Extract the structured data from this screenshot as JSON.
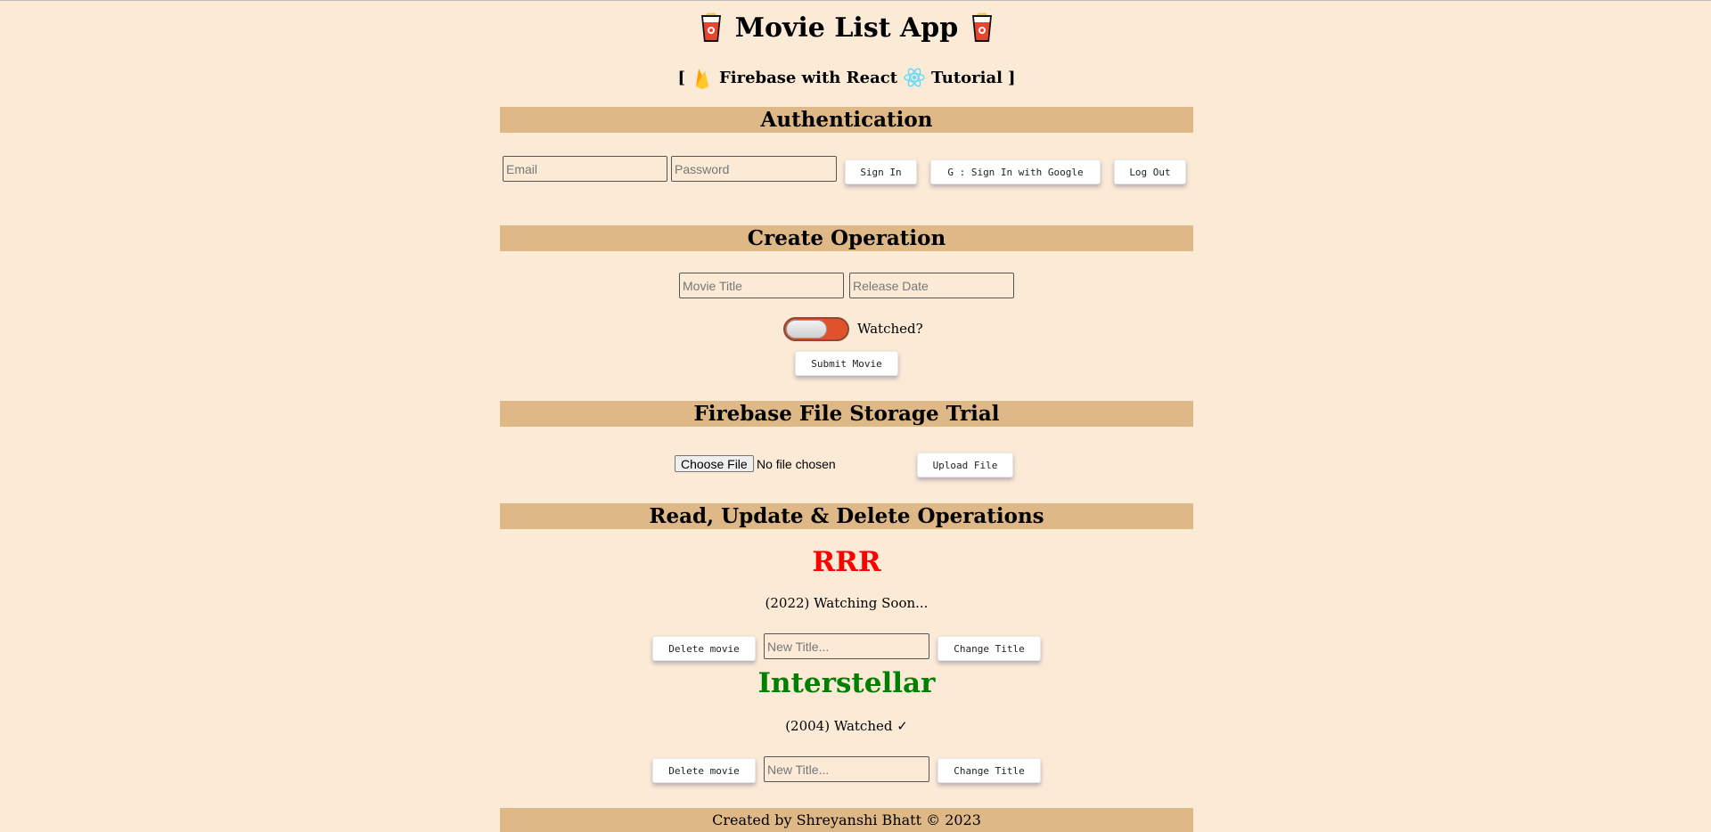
{
  "header": {
    "title": "Movie List App",
    "subtitle_open": "[",
    "subtitle_part1": "Firebase with React",
    "subtitle_part2": "Tutorial",
    "subtitle_close": "]",
    "icons": [
      "popcorn-icon",
      "firebase-icon",
      "react-icon"
    ]
  },
  "auth": {
    "heading": "Authentication",
    "email_placeholder": "Email",
    "email_value": "",
    "password_placeholder": "Password",
    "password_value": "",
    "sign_in_label": "Sign In",
    "google_label": "G : Sign In with Google",
    "logout_label": "Log Out"
  },
  "create": {
    "heading": "Create Operation",
    "title_placeholder": "Movie Title",
    "title_value": "",
    "date_placeholder": "Release Date",
    "date_value": "",
    "watched_label": "Watched?",
    "watched_checked": false,
    "submit_label": "Submit Movie"
  },
  "storage": {
    "heading": "Firebase File Storage Trial",
    "choose_label": "Choose File",
    "file_status": "No file chosen",
    "upload_label": "Upload File"
  },
  "rud": {
    "heading": "Read, Update & Delete Operations",
    "movies": [
      {
        "title": "RRR",
        "meta": "(2022) Watching Soon...",
        "title_color": "#ff0000",
        "delete_label": "Delete movie",
        "new_title_placeholder": "New Title...",
        "change_label": "Change Title"
      },
      {
        "title": "Interstellar",
        "meta": "(2004) Watched ✓",
        "title_color": "#008000",
        "delete_label": "Delete movie",
        "new_title_placeholder": "New Title...",
        "change_label": "Change Title"
      }
    ]
  },
  "footer": {
    "text": "Created by Shreyanshi Bhatt © 2023"
  },
  "colors": {
    "background": "#fbead6",
    "section_bar": "#deb887",
    "toggle_track": "#e0522b"
  }
}
